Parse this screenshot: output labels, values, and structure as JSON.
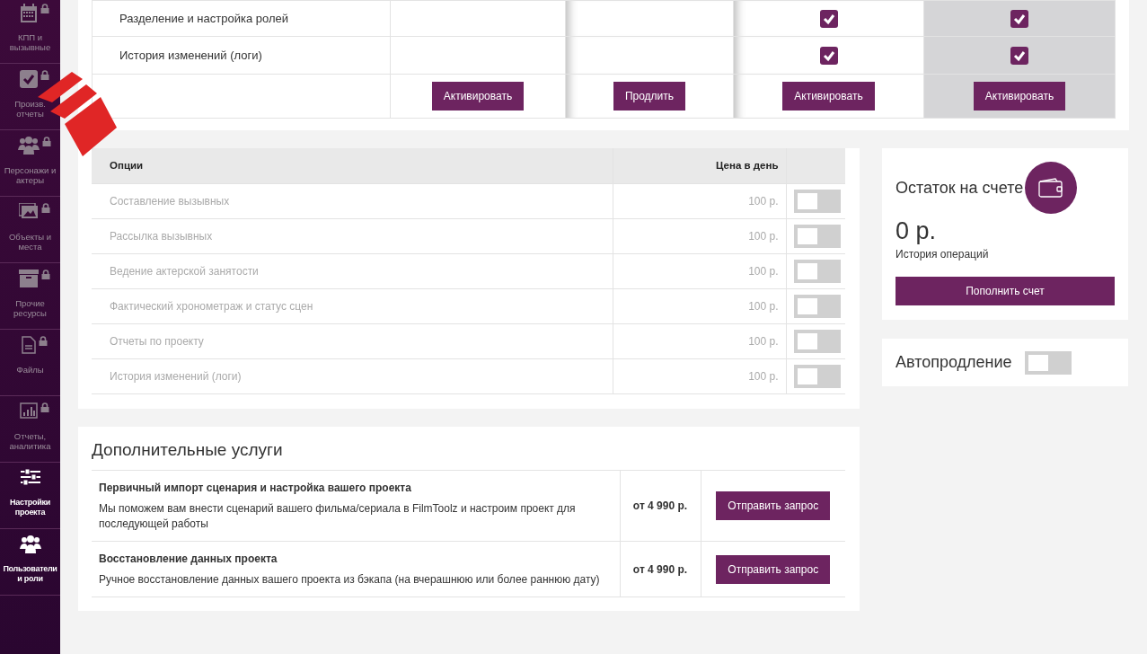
{
  "sidebar": {
    "items": [
      {
        "label": "КПП и вызывные",
        "kind": "calendar",
        "locked": true
      },
      {
        "label": "Произв. отчеты",
        "kind": "check",
        "locked": true
      },
      {
        "label": "Персонажи и актеры",
        "kind": "people",
        "locked": true
      },
      {
        "label": "Объекты и места",
        "kind": "image",
        "locked": true
      },
      {
        "label": "Прочие ресурсы",
        "kind": "archive",
        "locked": true
      },
      {
        "label": "Файлы",
        "kind": "file",
        "locked": true
      },
      {
        "label": "Отчеты, аналитика",
        "kind": "chart",
        "locked": true
      },
      {
        "label": "Настройки проекта",
        "kind": "sliders",
        "locked": false
      },
      {
        "label": "Пользователи и роли",
        "kind": "people",
        "locked": false
      }
    ]
  },
  "plans_table": {
    "columns": [
      {
        "highlighted": false,
        "action": "Активировать"
      },
      {
        "highlighted": false,
        "action": "Продлить"
      },
      {
        "highlighted": false,
        "action": "Активировать"
      },
      {
        "highlighted": true,
        "action": "Активировать"
      }
    ],
    "rows": [
      {
        "feature": "Разделение и настройка ролей",
        "included": [
          false,
          false,
          true,
          true
        ]
      },
      {
        "feature": "История изменений (логи)",
        "included": [
          false,
          false,
          true,
          true
        ]
      }
    ]
  },
  "options": {
    "columns": [
      "Опции",
      "Цена в день"
    ],
    "rows": [
      {
        "name": "Составление вызывных",
        "price": "100 р.",
        "on": false,
        "disabled": true
      },
      {
        "name": "Рассылка вызывных",
        "price": "100 р.",
        "on": false,
        "disabled": true
      },
      {
        "name": "Ведение актерской занятости",
        "price": "100 р.",
        "on": false,
        "disabled": true
      },
      {
        "name": "Фактический хронометраж и статус сцен",
        "price": "100 р.",
        "on": false,
        "disabled": true
      },
      {
        "name": "Отчеты по проекту",
        "price": "100 р.",
        "on": false,
        "disabled": true
      },
      {
        "name": "История изменений (логи)",
        "price": "100 р.",
        "on": false,
        "disabled": true
      }
    ]
  },
  "services": {
    "title": "Дополнительные услуги",
    "rows": [
      {
        "name": "Первичный импорт сценария и настройка вашего проекта",
        "description": "Мы поможем вам внести сценарий вашего фильма/сериала в FilmToolz и настроим проект для последующей работы",
        "price": "от 4 990 р.",
        "button": "Отправить запрос"
      },
      {
        "name": "Восстановление данных проекта",
        "description": "Ручное восстановление данных вашего проекта из бэкапа (на вчерашнюю или более раннюю дату)",
        "price": "от 4 990 р.",
        "button": "Отправить запрос"
      }
    ]
  },
  "balance": {
    "title": "Остаток на счете",
    "amount": "0 р.",
    "history_link": "История операций",
    "button": "Пополнить счет"
  },
  "autorenew": {
    "label": "Автопродление",
    "on": false
  }
}
